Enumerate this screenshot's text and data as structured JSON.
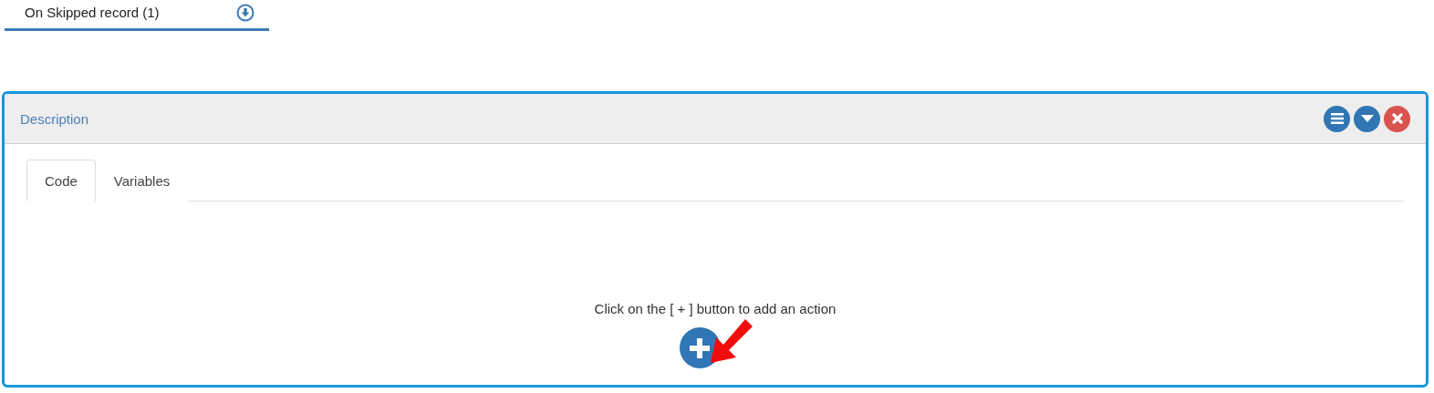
{
  "event_tab": {
    "label": "On Skipped record (1)"
  },
  "panel": {
    "title": "Description"
  },
  "tabs": [
    {
      "label": "Code",
      "selected": true
    },
    {
      "label": "Variables",
      "selected": false
    }
  ],
  "empty_message": "Click on the [ + ] button to add an action"
}
